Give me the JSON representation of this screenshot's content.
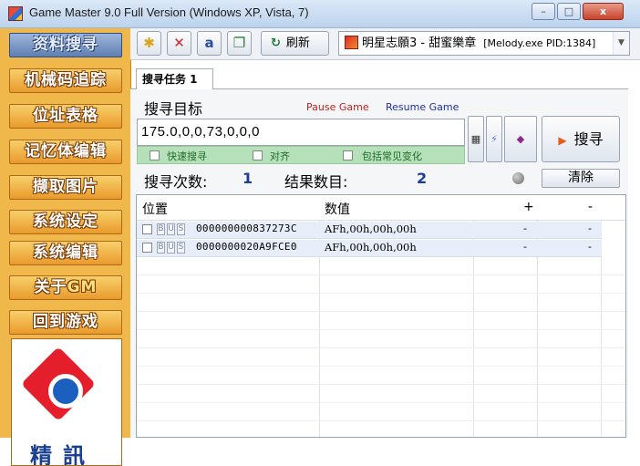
{
  "window": {
    "title": "Game Master 9.0 Full Version (Windows XP, Vista, 7)",
    "controls": {
      "minimize": "–",
      "maximize": "□",
      "close": "x"
    }
  },
  "sidebar": {
    "items": [
      {
        "label": "资料搜寻",
        "active": true
      },
      {
        "label": "机械码追踪"
      },
      {
        "label": "位址表格"
      },
      {
        "label": "记忆体编辑"
      },
      {
        "label": "撷取图片"
      },
      {
        "label": "系统设定"
      },
      {
        "label": "系统编辑"
      },
      {
        "label": "关于",
        "suffix": "GM"
      },
      {
        "label": "回到游戏"
      }
    ],
    "logo_text": "精訊"
  },
  "toolbar": {
    "icons": [
      "new-search-icon",
      "delete-icon",
      "text-icon",
      "copy-icon"
    ],
    "refresh_label": "刷新",
    "process_name": "明星志願3 - 甜蜜樂章",
    "process_pid": "[Melody.exe PID:1384]"
  },
  "tab": {
    "label": "搜寻任务 1"
  },
  "search": {
    "target_label": "搜寻目标",
    "pause_label": "Pause Game",
    "resume_label": "Resume Game",
    "target_value": "175.0,0,0,73,0,0,0",
    "options": [
      "快速搜寻",
      "对齐",
      "包括常见变化"
    ],
    "search_button": "搜寻",
    "count_label": "搜寻次数:",
    "count_value": "1",
    "results_label": "结果数目:",
    "results_value": "2",
    "clear_button": "清除"
  },
  "results": {
    "columns": [
      "位置",
      "数值",
      "+",
      "-"
    ],
    "rows": [
      {
        "address": "000000000837273C",
        "value": "AFh,00h,00h,00h",
        "plus": "-",
        "minus": "-"
      },
      {
        "address": "0000000020A9FCE0",
        "value": "AFh,00h,00h,00h",
        "plus": "-",
        "minus": "-"
      }
    ]
  },
  "colors": {
    "sidebar": "#f0b74a",
    "accent_blue": "#1c3b9c",
    "pause": "#c21f1f",
    "resume": "#1f2f9c"
  }
}
